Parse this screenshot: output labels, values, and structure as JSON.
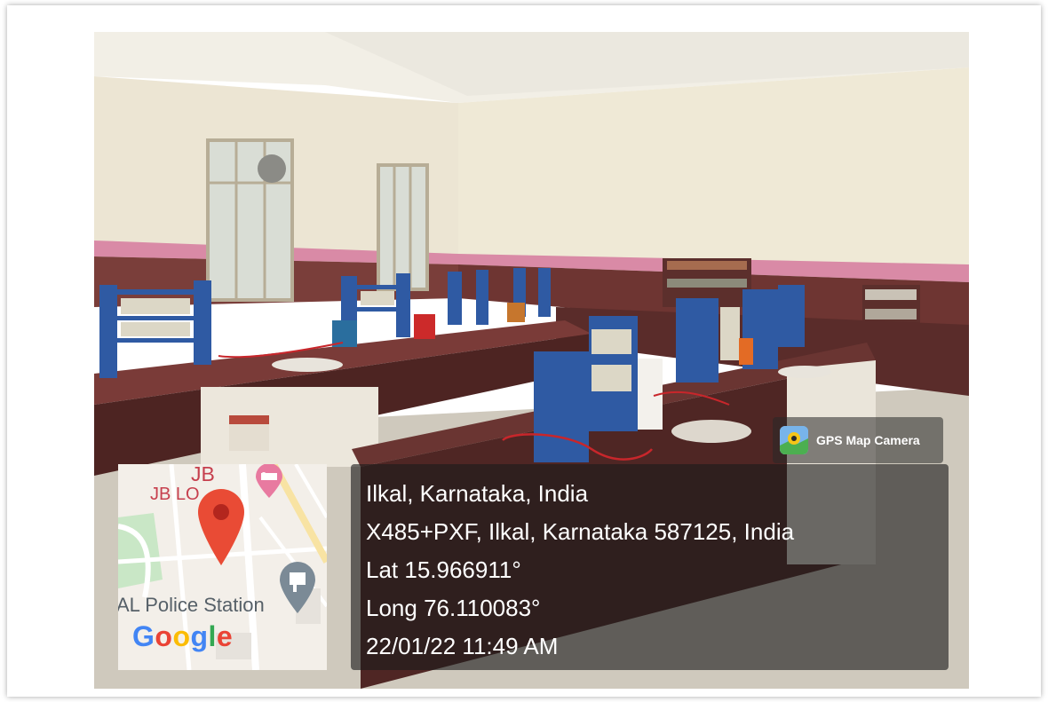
{
  "badge": {
    "label": "GPS Map Camera",
    "icon": "gps-camera-app-icon"
  },
  "map": {
    "labels": {
      "jb": "JB",
      "lodge": "JB LO",
      "police": "AL Police Station"
    },
    "logo": [
      "G",
      "o",
      "o",
      "g",
      "l",
      "e"
    ],
    "icons": [
      "map-pin-icon",
      "hotel-icon",
      "police-icon"
    ],
    "colors": {
      "pin": "#e94b35",
      "logo": [
        "#4285F4",
        "#EA4335",
        "#FBBC05",
        "#4285F4",
        "#34A853",
        "#EA4335"
      ]
    }
  },
  "location": {
    "title": "Ilkal, Karnataka, India",
    "address": "X485+PXF, Ilkal, Karnataka 587125, India",
    "lat": "Lat 15.966911°",
    "long": "Long 76.110083°",
    "datetime": "22/01/22 11:49 AM"
  }
}
